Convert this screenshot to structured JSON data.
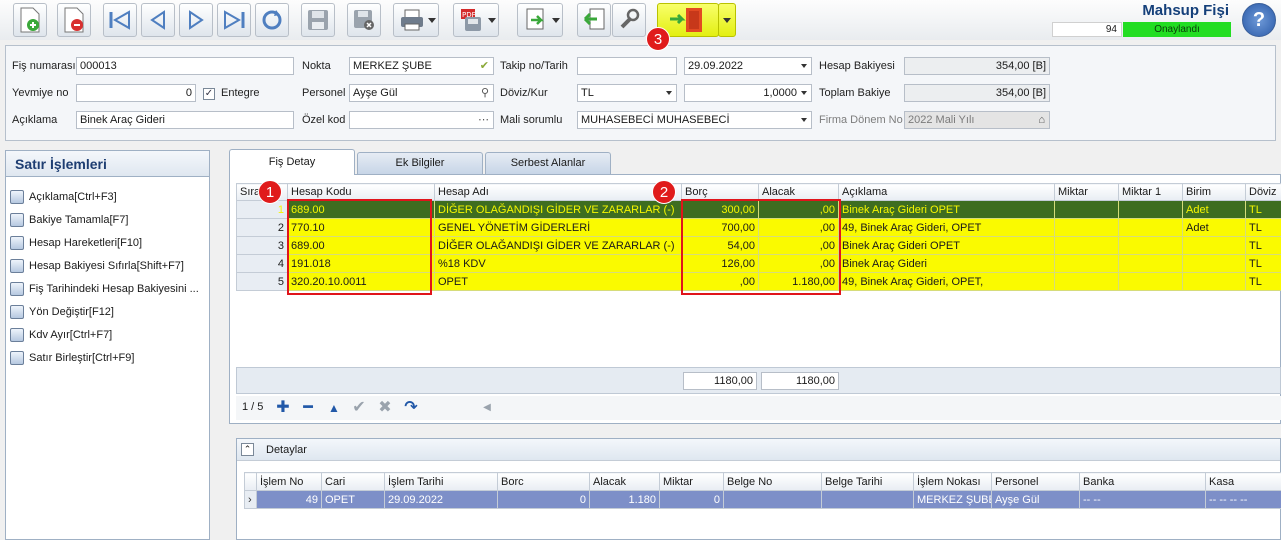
{
  "toolbar": {
    "buttons": [
      "new-icon",
      "delete-icon",
      "first-icon",
      "prev-icon",
      "next-icon",
      "last-icon",
      "refresh-icon",
      "save-icon",
      "cancel-icon",
      "print-icon",
      "pdf-icon",
      "export-icon",
      "back-icon",
      "tools-icon",
      "exit-icon"
    ],
    "title": "Mahsup Fişi",
    "doc_number": "94",
    "status": "Onaylandı",
    "status_color": "#22dd22",
    "help_label": "?"
  },
  "badges": {
    "b1": "1",
    "b2": "2",
    "b3": "3"
  },
  "form": {
    "fis_no_label": "Fiş numarası",
    "fis_no": "000013",
    "yevmiye_label": "Yevmiye no",
    "yevmiye": "0",
    "entegre_label": "Entegre",
    "aciklama_label": "Açıklama",
    "aciklama": "Binek Araç Gideri",
    "nokta_label": "Nokta",
    "nokta": "MERKEZ ŞUBE",
    "personel_label": "Personel",
    "personel": "Ayşe Gül",
    "ozel_kod_label": "Özel kod",
    "ozel_kod": "",
    "takip_label": "Takip no/Tarih",
    "takip": "",
    "tarih": "29.09.2022",
    "doviz_label": "Döviz/Kur",
    "doviz": "TL",
    "kur": "1,0000",
    "mali_label": "Mali sorumlu",
    "mali": "MUHASEBECİ MUHASEBECİ",
    "hesap_bakiyesi_label": "Hesap Bakiyesi",
    "hesap_bakiyesi": "354,00 [B]",
    "toplam_bakiye_label": "Toplam Bakiye",
    "toplam_bakiye": "354,00 [B]",
    "firma_donem_label": "Firma Dönem No",
    "firma_donem": "2022 Mali Yılı"
  },
  "left_panel": {
    "title": "Satır İşlemleri",
    "items": [
      "Açıklama[Ctrl+F3]",
      "Bakiye Tamamla[F7]",
      "Hesap Hareketleri[F10]",
      "Hesap Bakiyesi Sıfırla[Shift+F7]",
      "Fiş Tarihindeki Hesap Bakiyesini ...",
      "Yön Değiştir[F12]",
      "Kdv Ayır[Ctrl+F7]",
      "Satır Birleştir[Ctrl+F9]"
    ]
  },
  "tabs": [
    "Fiş Detay",
    "Ek Bilgiler",
    "Serbest Alanlar"
  ],
  "grid": {
    "columns": [
      "Sıra",
      "Hesap Kodu",
      "Hesap Adı",
      "Borç",
      "Alacak",
      "Açıklama",
      "Miktar",
      "Miktar 1",
      "Birim",
      "Döviz"
    ],
    "rows": [
      [
        "1",
        "689.00",
        "DİĞER OLAĞANDIŞI GİDER VE ZARARLAR (-)",
        "300,00",
        ",00",
        "Binek Araç Gideri OPET",
        "",
        "",
        "Adet",
        "TL"
      ],
      [
        "2",
        "770.10",
        "GENEL YÖNETİM GİDERLERİ",
        "700,00",
        ",00",
        "49, Binek Araç Gideri, OPET",
        "",
        "",
        "Adet",
        "TL"
      ],
      [
        "3",
        "689.00",
        "DİĞER OLAĞANDIŞI GİDER VE ZARARLAR (-)",
        "54,00",
        ",00",
        "Binek Araç Gideri OPET",
        "",
        "",
        "",
        "TL"
      ],
      [
        "4",
        "191.018",
        "%18 KDV",
        "126,00",
        ",00",
        "Binek Araç Gideri",
        "",
        "",
        "",
        "TL"
      ],
      [
        "5",
        "320.20.10.0011",
        "OPET",
        ",00",
        "1.180,00",
        "49, Binek Araç Gideri, OPET,",
        "",
        "",
        "",
        "TL"
      ]
    ],
    "total_borc": "1180,00",
    "total_alacak": "1180,00",
    "record_pos": "1 / 5"
  },
  "details": {
    "title": "Detaylar",
    "columns": [
      "İşlem No",
      "Cari",
      "İşlem Tarihi",
      "Borc",
      "Alacak",
      "Miktar",
      "Belge No",
      "Belge Tarihi",
      "İşlem Nokası",
      "Personel",
      "Banka",
      "Kasa"
    ],
    "rows": [
      [
        "49",
        "OPET",
        "29.09.2022",
        "0",
        "1.180",
        "0",
        "",
        "",
        "MERKEZ ŞUBE",
        "Ayşe Gül",
        "-- --",
        "-- -- -- --"
      ]
    ]
  }
}
